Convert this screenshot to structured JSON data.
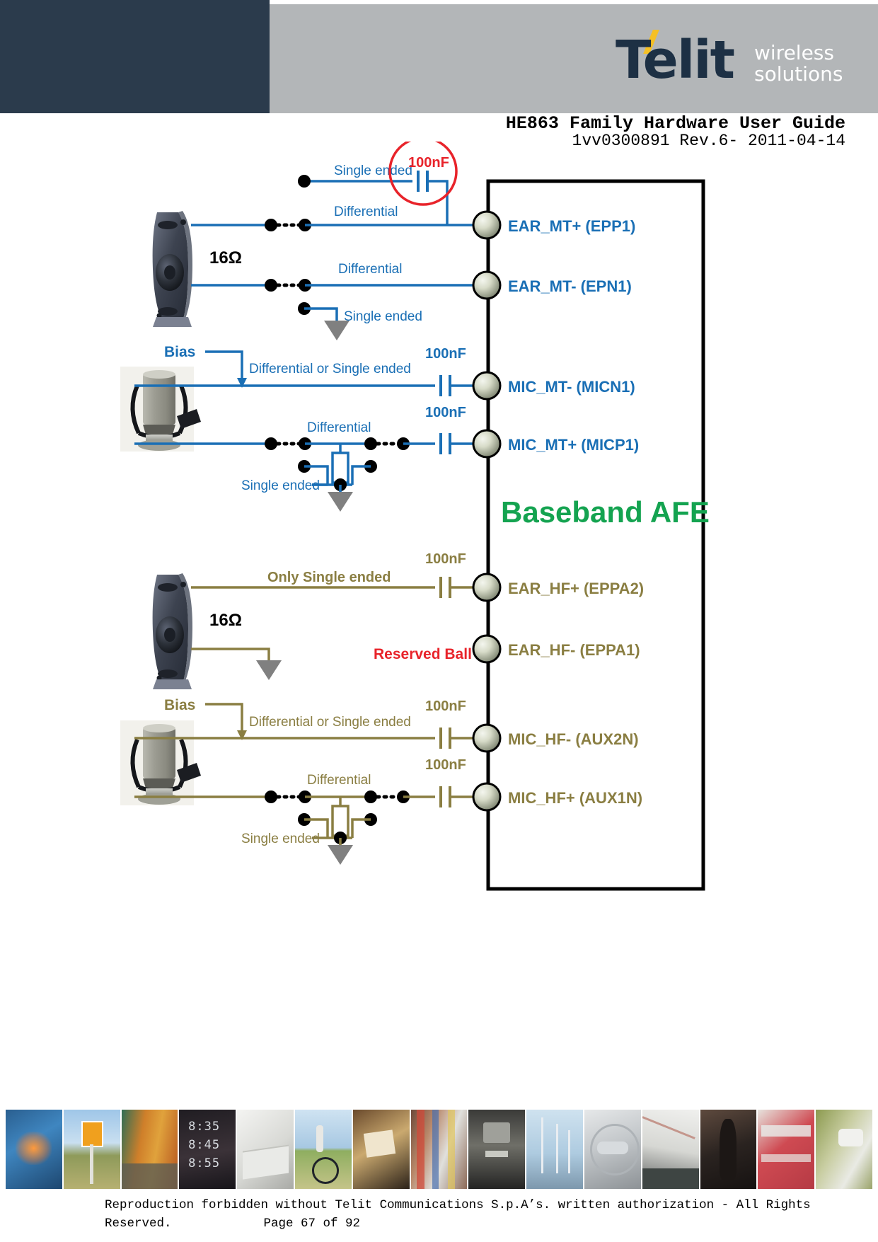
{
  "header": {
    "logo_brand": "Telit",
    "logo_tagline_line1": "wireless",
    "logo_tagline_line2": "solutions",
    "doc_title": "HE863 Family Hardware User Guide",
    "doc_subtitle": "1vv0300891 Rev.6- 2011-04-14"
  },
  "diagram": {
    "block_label": "Baseband AFE",
    "reserved_note": "Reserved Ball",
    "colors": {
      "mt_blue": "#1a6fb5",
      "hf_olive": "#8a7e42",
      "green": "#14a350",
      "red": "#e8232a",
      "black": "#000000",
      "grey_triangle": "#808080"
    },
    "mt_section": {
      "speaker_impedance": "16Ω",
      "bias_label": "Bias",
      "highlight_cap": "100nF",
      "labels": {
        "ear_single_ended": "Single ended",
        "ear_plus_differential": "Differential",
        "ear_minus_differential": "Differential",
        "ear_minus_single_ended": "Single ended",
        "mic_minus_mode": "Differential or Single ended",
        "mic_plus_differential": "Differential",
        "mic_plus_single_ended": "Single ended",
        "mic_minus_cap": "100nF",
        "mic_plus_cap": "100nF"
      },
      "pins": [
        {
          "name": "EAR_MT+ (EPP1)"
        },
        {
          "name": "EAR_MT- (EPN1)"
        },
        {
          "name": "MIC_MT- (MICN1)"
        },
        {
          "name": "MIC_MT+ (MICP1)"
        }
      ]
    },
    "hf_section": {
      "speaker_impedance": "16Ω",
      "bias_label": "Bias",
      "labels": {
        "ear_only_single_ended": "Only Single ended",
        "ear_hf_cap": "100nF",
        "mic_minus_mode": "Differential or Single ended",
        "mic_minus_cap": "100nF",
        "mic_plus_differential": "Differential",
        "mic_plus_single_ended": "Single ended",
        "mic_plus_cap": "100nF"
      },
      "pins": [
        {
          "name": "EAR_HF+ (EPPA2)"
        },
        {
          "name": "EAR_HF- (EPPA1)"
        },
        {
          "name": "MIC_HF- (AUX2N)"
        },
        {
          "name": "MIC_HF+ (AUX1N)"
        }
      ]
    }
  },
  "footer": {
    "line1": "Reproduction forbidden without Telit Communications S.p.A’s. written authorization - All Rights",
    "line2": "Reserved.",
    "page": "Page 67 of 92"
  }
}
